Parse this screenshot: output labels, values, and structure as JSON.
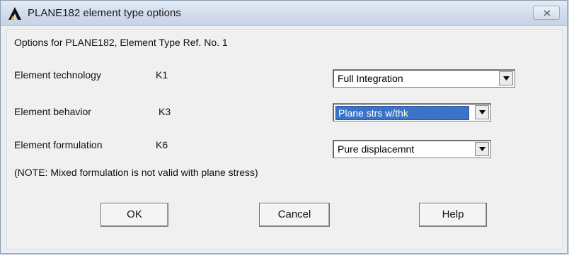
{
  "window": {
    "title": "PLANE182 element type options",
    "heading": "Options for PLANE182, Element Type Ref. No. 1"
  },
  "rows": [
    {
      "label": "Element technology",
      "key": "K1",
      "value": "Full Integration",
      "focused": false
    },
    {
      "label": "Element behavior",
      "key": "K3",
      "value": "Plane strs w/thk",
      "focused": true
    },
    {
      "label": "Element formulation",
      "key": "K6",
      "value": "Pure displacemnt",
      "focused": false
    }
  ],
  "note": "(NOTE: Mixed formulation is not valid with plane stress)",
  "buttons": {
    "ok": "OK",
    "cancel": "Cancel",
    "help": "Help"
  },
  "colors": {
    "selection": "#3b74c6",
    "titlebar": "#d2dded"
  },
  "icons": {
    "app": "ansys-logo-icon",
    "close": "close-icon",
    "dropdown": "chevron-down-icon"
  }
}
